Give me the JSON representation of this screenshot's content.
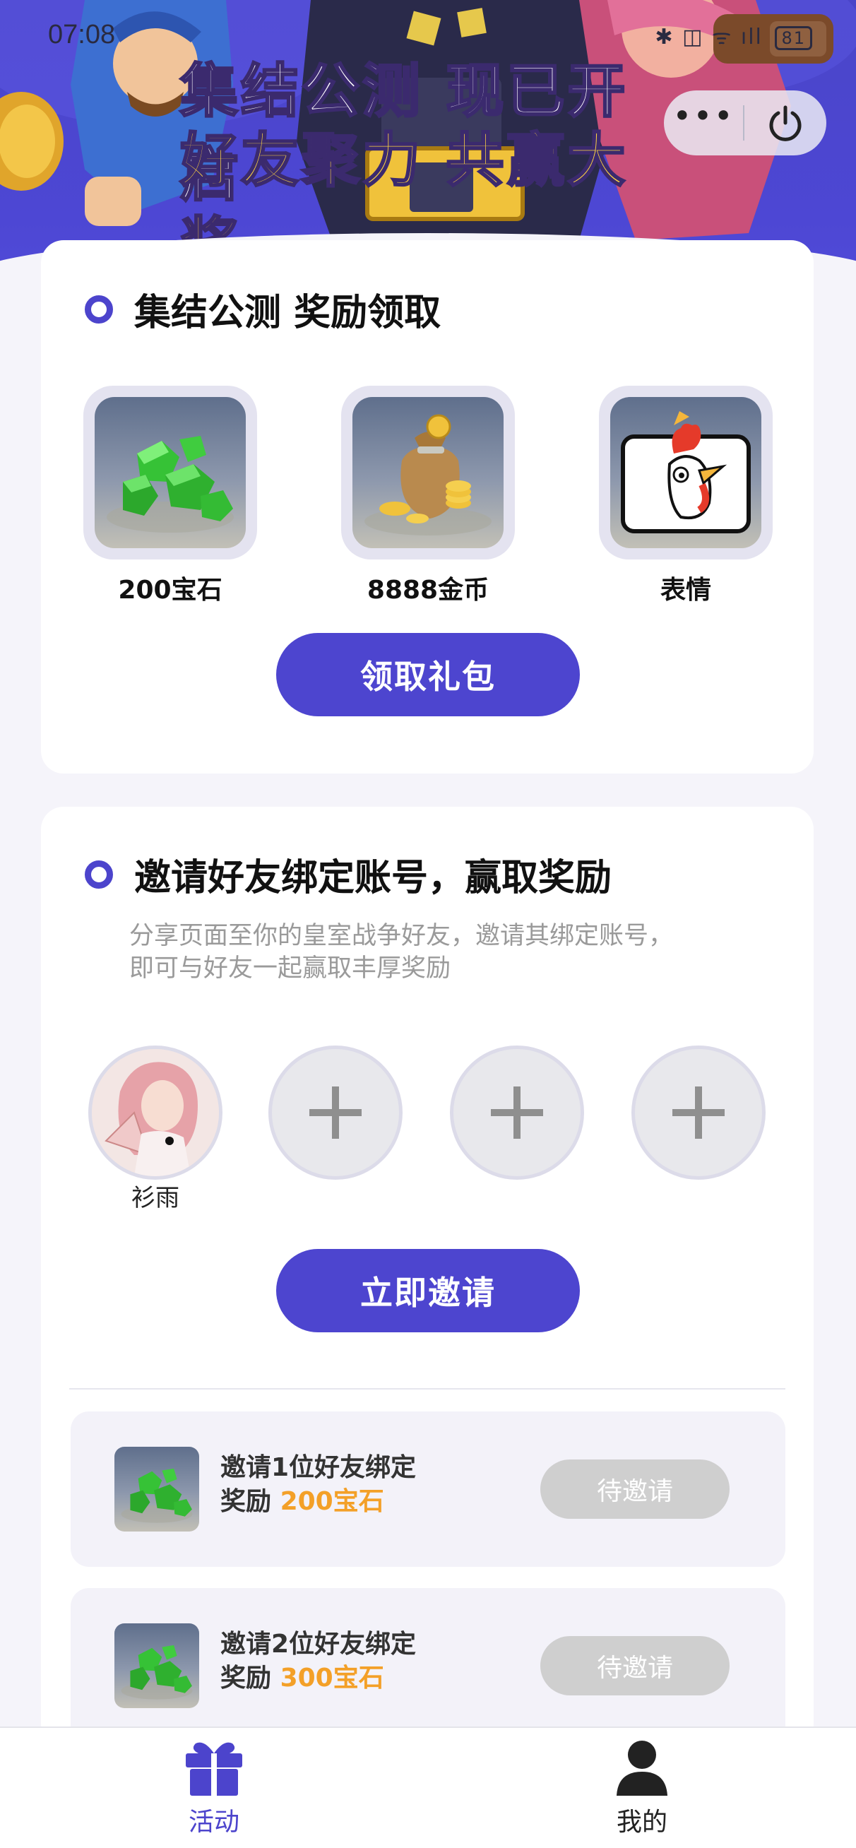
{
  "status_bar": {
    "time": "07:08",
    "indicators": "✱ ◫ ᯤ ıll",
    "battery": "81"
  },
  "banner": {
    "headline_line1": "集结公测 现已开启",
    "headline_line2": "好友聚力 共赢大奖"
  },
  "capsule": {
    "more_label": "•••"
  },
  "reward_card": {
    "title": "集结公测 奖励领取",
    "items": [
      {
        "label": "200宝石",
        "icon": "gems-icon"
      },
      {
        "label": "8888金币",
        "icon": "coin-bag-icon"
      },
      {
        "label": "表情",
        "icon": "chicken-emote-icon"
      }
    ],
    "claim_button": "领取礼包"
  },
  "invite_card": {
    "title": "邀请好友绑定账号，赢取奖励",
    "description_line1": "分享页面至你的皇室战争好友，邀请其绑定账号，",
    "description_line2": "即可与好友一起赢取丰厚奖励",
    "friends": [
      {
        "name": "衫雨"
      }
    ],
    "invite_button": "立即邀请",
    "tasks": [
      {
        "title": "邀请1位好友绑定",
        "reward_prefix": "奖励",
        "reward": "200宝石",
        "status": "待邀请"
      },
      {
        "title": "邀请2位好友绑定",
        "reward_prefix": "奖励",
        "reward": "300宝石",
        "status": "待邀请"
      }
    ]
  },
  "tabbar": {
    "tabs": [
      {
        "label": "活动",
        "icon": "gift-icon",
        "active": true
      },
      {
        "label": "我的",
        "icon": "person-icon",
        "active": false
      }
    ]
  },
  "colors": {
    "accent": "#4d45cf",
    "reward_highlight": "#f3a028",
    "banner_bg": "#4a45c8"
  }
}
